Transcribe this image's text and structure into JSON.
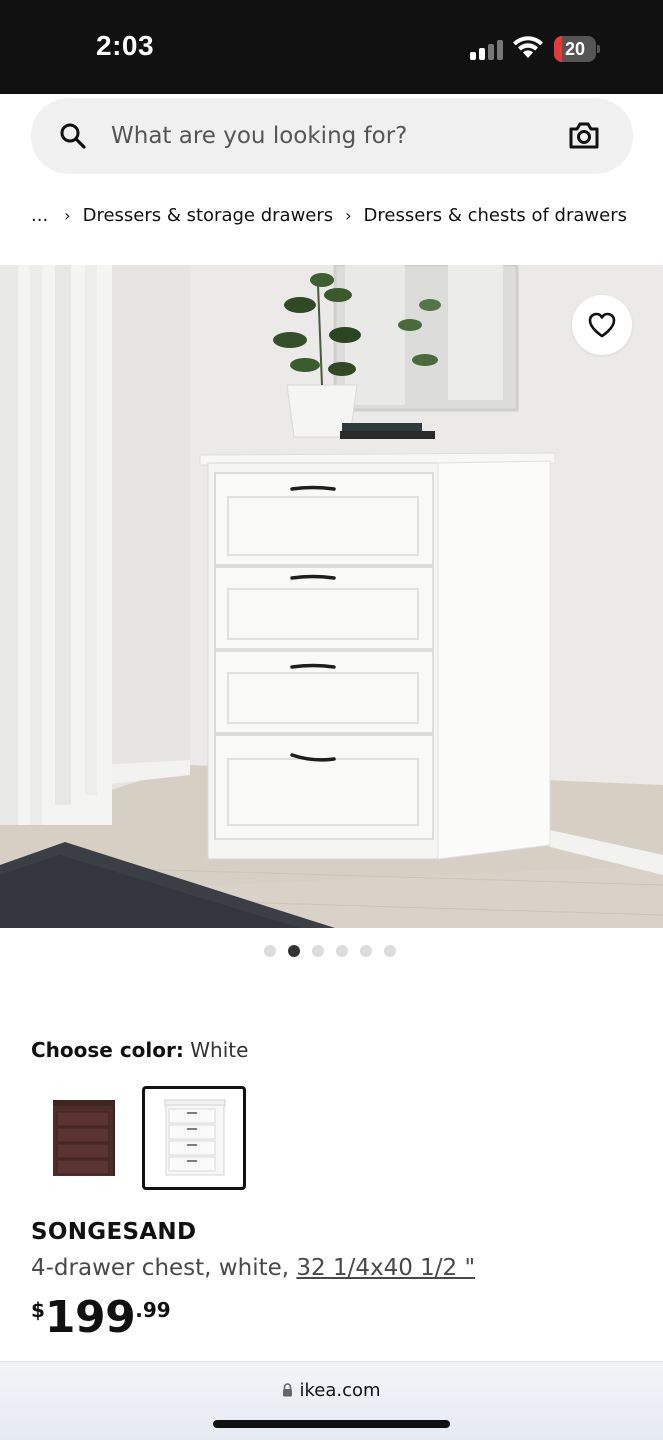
{
  "status_bar": {
    "time": "2:03",
    "battery_level": "20",
    "battery_color": "#e53935"
  },
  "search": {
    "placeholder": "What are you looking for?",
    "search_icon": "search-icon",
    "camera_icon": "camera-icon"
  },
  "breadcrumb": {
    "ellipsis": "...",
    "items": [
      "Dressers & storage drawers",
      "Dressers & chests of drawers"
    ]
  },
  "product_image": {
    "favorite_icon": "heart-icon",
    "total_images": 6,
    "active_index": 2
  },
  "color_chooser": {
    "label": "Choose color:",
    "selected": "White",
    "swatches": [
      "brown",
      "white"
    ]
  },
  "product": {
    "name": "SONGESAND",
    "description": "4-drawer chest, white, ",
    "dimensions": "32 1/4x40 1/2 \"",
    "price": {
      "currency": "$",
      "whole": "199",
      "cents": ".99"
    }
  },
  "browser": {
    "url": "ikea.com"
  }
}
